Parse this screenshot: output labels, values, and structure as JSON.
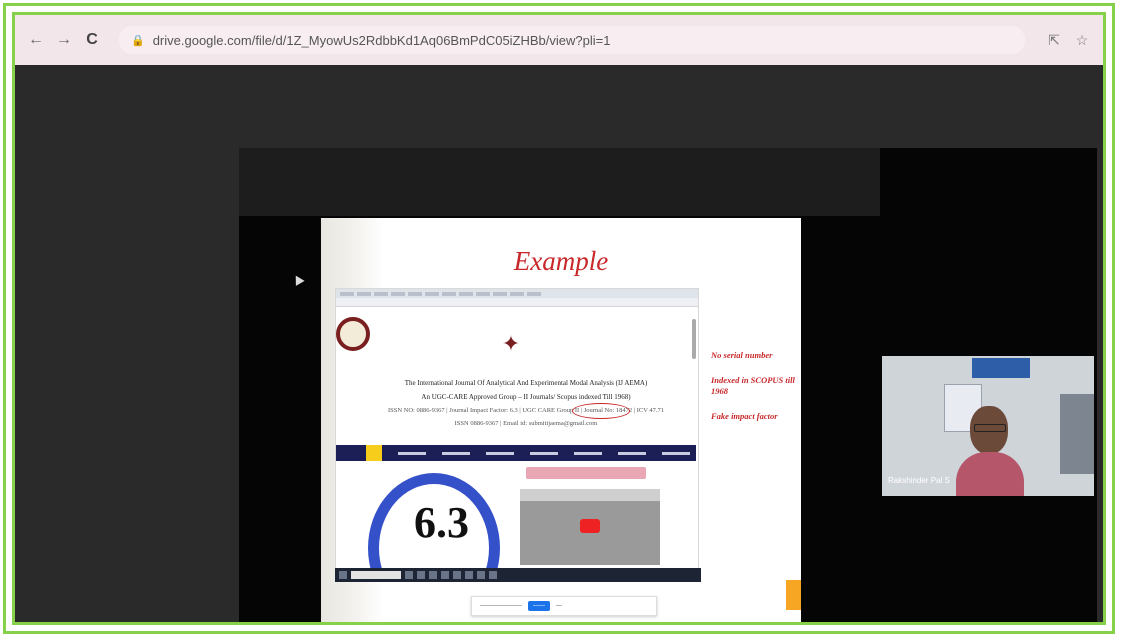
{
  "browser": {
    "url": "drive.google.com/file/d/1Z_MyowUs2RdbbKd1Aq06BmPdC05iZHBb/view?pli=1",
    "back_icon": "arrow-left-icon",
    "forward_icon": "arrow-right-icon",
    "reload_icon": "reload-icon",
    "share_icon": "share-icon",
    "bookmark_icon": "star-icon"
  },
  "slide": {
    "title": "Example",
    "journal_title": "The International Journal Of Analytical And Experimental Modal Analysis (IJ AEMA)",
    "journal_group": "An UGC-CARE Approved Group – II Journals/ Scopus indexed Till 1968)",
    "journal_issn": "ISSN NO: 0886-9367 | Journal Impact Factor: 6.3 | UGC CARE Group II | Journal No: 18472 | ICV 47.71",
    "journal_email": "ISSN 0886-9367 | Email id: submitijaema@gmail.com",
    "impact_factor": "6.3",
    "notes": [
      "No serial number",
      "Indexed in SCOPUS till 1968",
      "Fake impact factor"
    ]
  },
  "participant": {
    "name": "Rakshinder Pal S"
  }
}
